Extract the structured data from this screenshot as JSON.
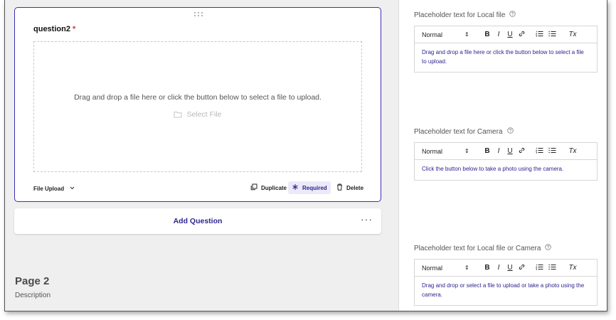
{
  "question": {
    "title": "question2",
    "required_marker": "*",
    "dropzone_text": "Drag and drop a file here or click the button below to select a file to upload.",
    "select_file_label": "Select File",
    "type_label": "File Upload",
    "duplicate_label": "Duplicate",
    "required_label": "Required",
    "delete_label": "Delete"
  },
  "add_question": {
    "label": "Add Question",
    "more": "···"
  },
  "page": {
    "title": "Page 2",
    "description": "Description"
  },
  "settings": {
    "sections": [
      {
        "label": "Placeholder text for Local file",
        "format": "Normal",
        "text": "Drag and drop a file here or click the button below to select a file to upload."
      },
      {
        "label": "Placeholder text for Camera",
        "format": "Normal",
        "text": "Click the button below to take a photo using the camera."
      },
      {
        "label": "Placeholder text for Local file or Camera",
        "format": "Normal",
        "text": "Drag and drop or select a file to upload or take a photo using the camera."
      }
    ]
  },
  "toolbar": {
    "bold": "B",
    "italic": "I",
    "underline": "U",
    "clear": "Tx",
    "updown": "⇕"
  },
  "colors": {
    "accent": "#2e248f",
    "card_border": "#3c2fb5",
    "required_star": "#d32f2f",
    "required_bg": "#eceaf8"
  }
}
